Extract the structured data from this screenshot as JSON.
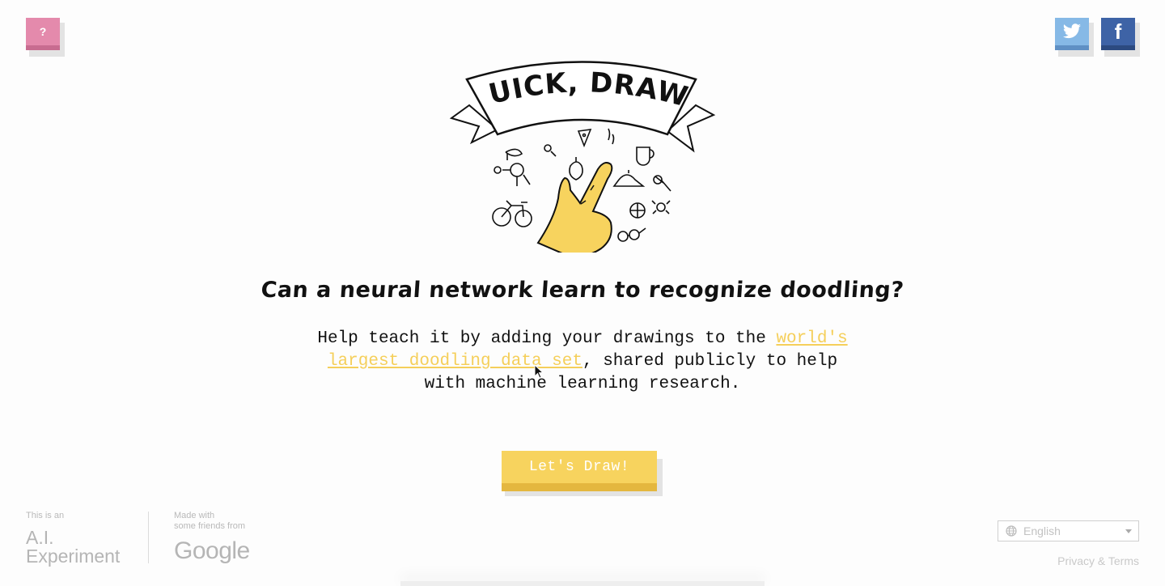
{
  "header": {
    "help_label": "?",
    "facebook_label": "f"
  },
  "logo": {
    "banner_text": "QUICK, DRAW!"
  },
  "main": {
    "headline": "Can a neural network learn to recognize doodling?",
    "description_before": "Help teach it by adding your drawings to the ",
    "description_link": "world's largest doodling data set",
    "description_after": ", shared publicly to help with machine learning research.",
    "cta_label": "Let's Draw!"
  },
  "footer": {
    "experiment_caption": "This is an",
    "experiment_line1": "A.I.",
    "experiment_line2": "Experiment",
    "made_with_line1": "Made with",
    "made_with_line2": "some friends from",
    "google_word": "Google",
    "language_selected": "English",
    "privacy_link": "Privacy & Terms"
  },
  "colors": {
    "help_pink": "#e48aac",
    "twitter_blue": "#86b9e6",
    "facebook_blue": "#3e63a6",
    "accent_yellow": "#f7d35e",
    "link_yellow": "#f5cf5a"
  },
  "icons": [
    "question-icon",
    "twitter-icon",
    "facebook-icon",
    "globe-icon",
    "chevron-down-icon",
    "pointer-cursor-icon"
  ]
}
